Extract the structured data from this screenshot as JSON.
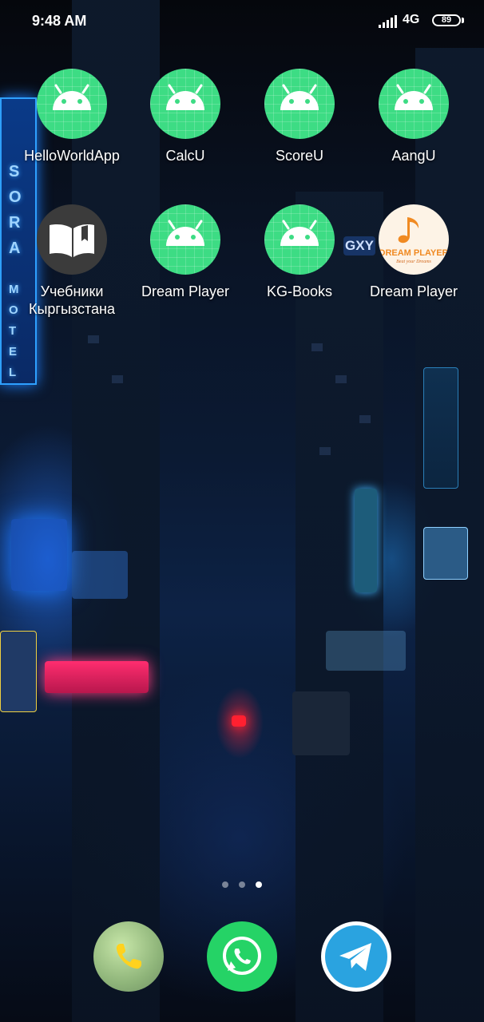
{
  "status_bar": {
    "time": "9:48 AM",
    "network": "4G",
    "battery": "89"
  },
  "home": {
    "apps": [
      {
        "label": "HelloWorldApp",
        "icon": "android-icon"
      },
      {
        "label": "CalcU",
        "icon": "android-icon"
      },
      {
        "label": "ScoreU",
        "icon": "android-icon"
      },
      {
        "label": "AangU",
        "icon": "android-icon"
      },
      {
        "label": "Учебники\nКыргызстана",
        "icon": "book-icon"
      },
      {
        "label": "Dream Player",
        "icon": "android-icon"
      },
      {
        "label": "KG-Books",
        "icon": "android-icon"
      },
      {
        "label": "Dream Player",
        "icon": "dream-player-icon",
        "icon_text": "DREAM PLAYER",
        "icon_subtext": "Beat your Dreams"
      }
    ],
    "pages": {
      "count": 3,
      "current": 3
    },
    "wallpaper_text": {
      "sign": "SORA MOTEL",
      "billboard": "GXY"
    }
  },
  "dock": [
    {
      "icon": "phone-icon",
      "color": "#9ccb8a"
    },
    {
      "icon": "whatsapp-icon",
      "color": "#25d366"
    },
    {
      "icon": "telegram-icon",
      "color": "#2aa3e0"
    }
  ]
}
